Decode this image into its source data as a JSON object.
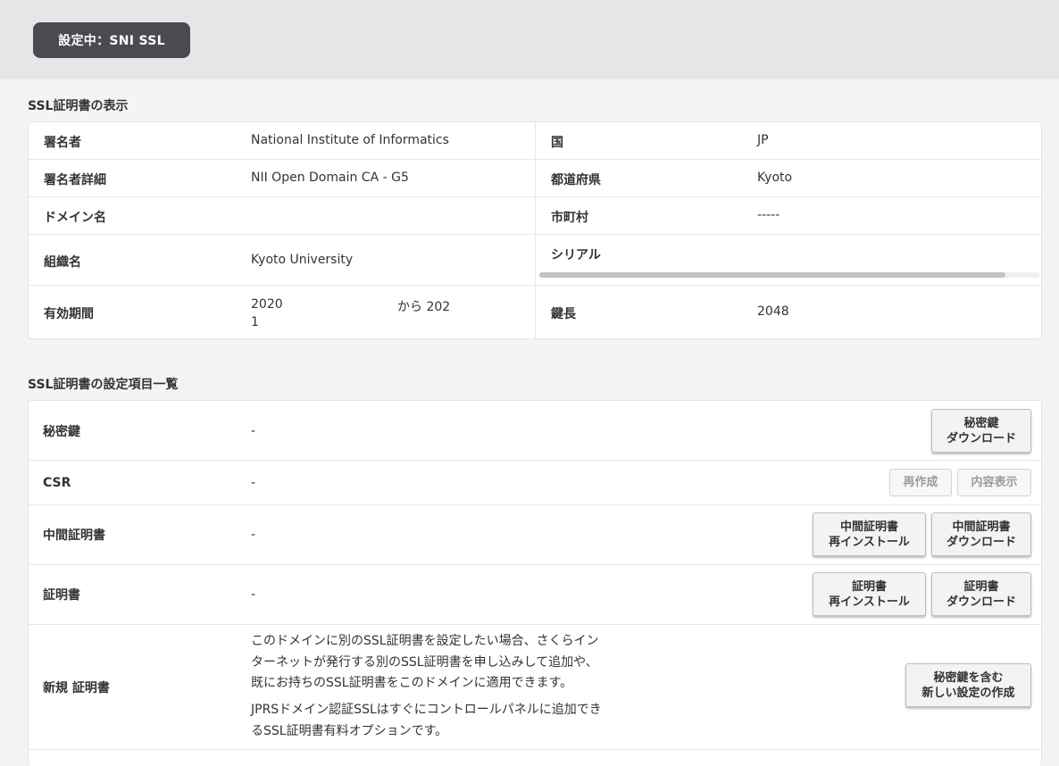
{
  "header": {
    "status": "設定中：SNI SSL"
  },
  "cert_view": {
    "title": "SSL証明書の表示",
    "rows": [
      {
        "l1": "署名者",
        "v1": "National Institute of Informatics",
        "l2": "国",
        "v2": "JP"
      },
      {
        "l1": "署名者詳細",
        "v1": "NII Open Domain CA - G5",
        "l2": "都道府県",
        "v2": "Kyoto"
      },
      {
        "l1": "ドメイン名",
        "v1": "",
        "l2": "市町村",
        "v2": "-----"
      },
      {
        "l1": "組織名",
        "v1": "Kyoto University",
        "l2": "シリアル",
        "v2": ""
      },
      {
        "l1": "有効期間",
        "v1_line1": "2020",
        "v1_mid": "から 202",
        "v1_line2": "1",
        "l2": "鍵長",
        "v2": "2048"
      }
    ]
  },
  "settings": {
    "title": "SSL証明書の設定項目一覧",
    "private_key": {
      "label": "秘密鍵",
      "value": "-",
      "download": "秘密鍵\nダウンロード"
    },
    "csr": {
      "label": "CSR",
      "value": "-",
      "recreate": "再作成",
      "show": "内容表示"
    },
    "intermediate": {
      "label": "中間証明書",
      "value": "-",
      "reinstall": "中間証明書\n再インストール",
      "download": "中間証明書\nダウンロード"
    },
    "certificate": {
      "label": "証明書",
      "value": "-",
      "reinstall": "証明書\n再インストール",
      "download": "証明書\nダウンロード"
    },
    "new_cert": {
      "label": "新規 証明書",
      "desc_lines": [
        "このドメインに別のSSL証明書を設定したい場合、さくらイン",
        "ターネットが発行する別のSSL証明書を申し込みして追加や、",
        "既にお持ちのSSL証明書をこのドメインに適用できます。"
      ],
      "desc2_lines": [
        "JPRSドメイン認証SSLはすぐにコントロールパネルに追加でき",
        "るSSL証明書有料オプションです。"
      ],
      "create": "秘密鍵を含む\n新しい設定の作成"
    }
  }
}
